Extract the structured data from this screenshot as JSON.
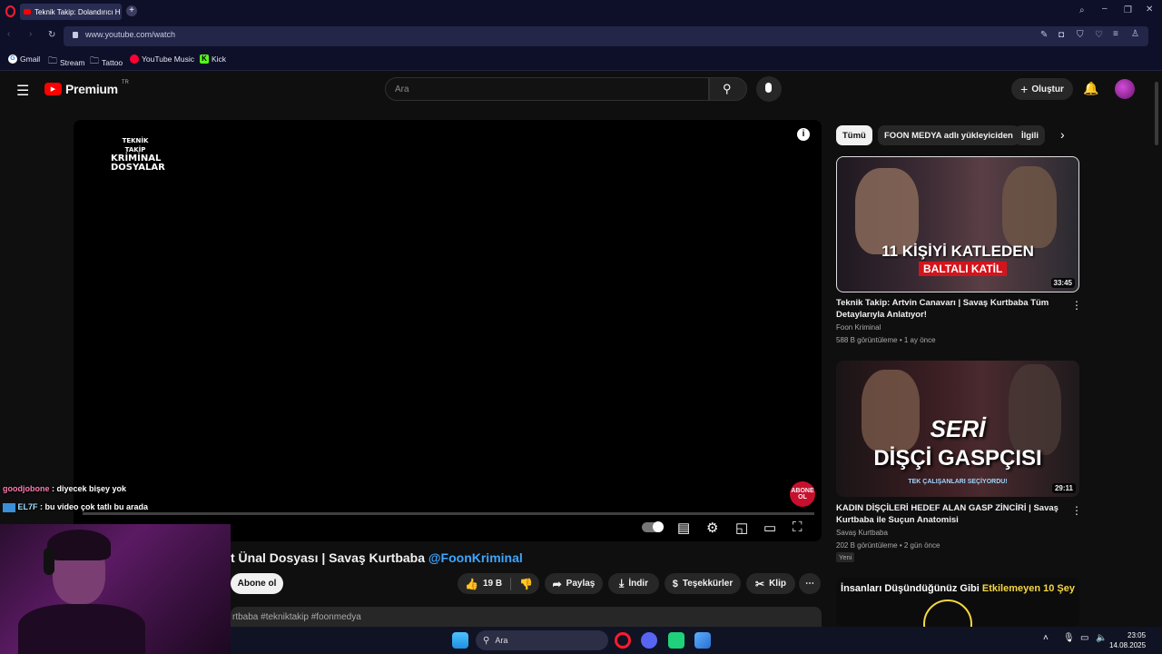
{
  "browser": {
    "tab_title": "Teknik Takip: Dolandırıcı H",
    "url": "www.youtube.com/watch",
    "bookmarks": [
      "Gmail",
      "Stream",
      "Tattoo",
      "YouTube Music",
      "Kick"
    ]
  },
  "yt_header": {
    "logo_text": "Premium",
    "region": "TR",
    "search_placeholder": "Ara",
    "create_label": "Oluştur"
  },
  "player": {
    "brand_line1": "TEKNİK TAKİP",
    "brand_line2": "KRİMİNAL",
    "brand_line3": "DOSYALAR",
    "subscribe_badge": "ABONE OL"
  },
  "video": {
    "title_visible": "t Ünal Dosyası | Savaş Kurtbaba",
    "channel_mention": "@FoonKriminal",
    "subscribe_label": "Abone ol",
    "likes": "19 B",
    "share_label": "Paylaş",
    "download_label": "İndir",
    "thanks_label": "Teşekkürler",
    "clip_label": "Klip",
    "description_preview": "rtbaba #tekniktakip #foonmedya"
  },
  "chips": [
    "Tümü",
    "FOON MEDYA adlı yükleyiciden",
    "İlgili"
  ],
  "recommendations": [
    {
      "thumb_text_1": "11 KİŞİYİ KATLEDEN",
      "thumb_text_2": "BALTALI KATİL",
      "duration": "33:45",
      "title": "Teknik Takip: Artvin Canavarı | Savaş Kurtbaba Tüm Detaylarıyla Anlatıyor!",
      "channel": "Foon Kriminal",
      "meta": "588 B görüntüleme • 1 ay önce",
      "badge": ""
    },
    {
      "thumb_text_1": "SERİ",
      "thumb_text_2": "DİŞÇİ GASPÇISI",
      "thumb_text_3": "TEK ÇALIŞANLARI SEÇİYORDU!",
      "duration": "29:11",
      "title": "KADIN DİŞÇİLERİ HEDEF ALAN GASP ZİNCİRİ | Savaş Kurtbaba ile Suçun Anatomisi",
      "channel": "Savaş Kurtbaba",
      "meta": "202 B görüntüleme • 2 gün önce",
      "badge": "Yeni"
    },
    {
      "thumb_text_1": "İnsanları Düşündüğünüz Gibi Etkilemeyen 10 Şey",
      "thumb_highlight": "Etkilemeyen 10 Şey"
    }
  ],
  "chat": [
    {
      "user": "goodjobone",
      "message": "diyecek bişey yok",
      "user_color": "#ff7ab0"
    },
    {
      "user": "EL7F",
      "message": "bu video çok tatlı bu arada",
      "user_color": "#9fe0ff"
    }
  ],
  "taskbar": {
    "search_placeholder": "Ara",
    "time": "23:05",
    "date": "14.08.2025"
  },
  "colors": {
    "youtube_red": "#ff0000",
    "link_blue": "#3ea6ff",
    "browser_bg": "#0e1029",
    "page_bg": "#0f0f0f"
  }
}
